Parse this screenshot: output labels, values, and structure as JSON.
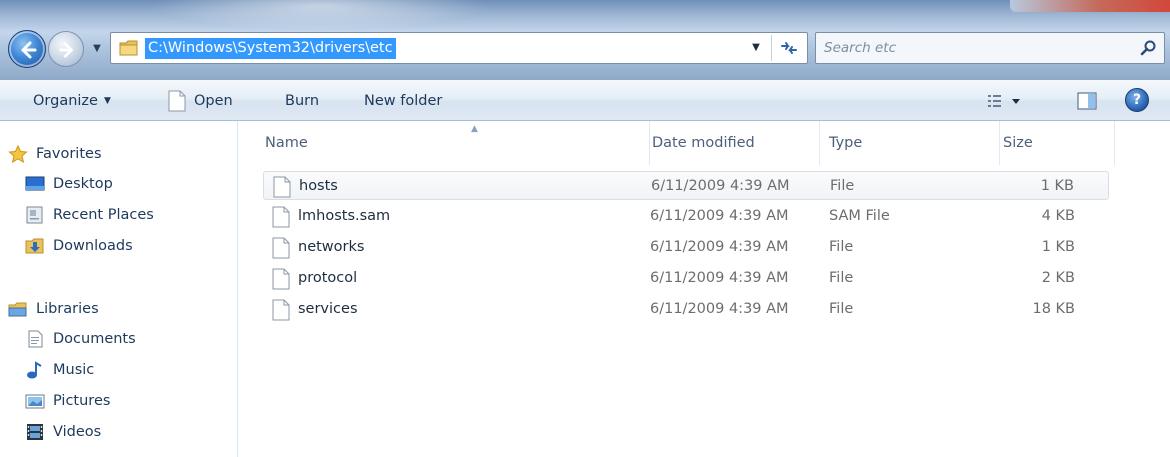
{
  "address": {
    "path": "C:\\Windows\\System32\\drivers\\etc"
  },
  "search": {
    "placeholder": "Search etc"
  },
  "toolbar": {
    "organize_label": "Organize",
    "open_label": "Open",
    "burn_label": "Burn",
    "new_folder_label": "New folder",
    "help_label": "?"
  },
  "sidebar": {
    "favorites": {
      "label": "Favorites",
      "items": [
        {
          "label": "Desktop",
          "icon": "desktop-icon"
        },
        {
          "label": "Recent Places",
          "icon": "recent-places-icon"
        },
        {
          "label": "Downloads",
          "icon": "downloads-icon"
        }
      ]
    },
    "libraries": {
      "label": "Libraries",
      "items": [
        {
          "label": "Documents",
          "icon": "documents-icon"
        },
        {
          "label": "Music",
          "icon": "music-icon"
        },
        {
          "label": "Pictures",
          "icon": "pictures-icon"
        },
        {
          "label": "Videos",
          "icon": "videos-icon"
        }
      ]
    }
  },
  "filelist": {
    "columns": {
      "name": "Name",
      "date": "Date modified",
      "type": "Type",
      "size": "Size"
    },
    "rows": [
      {
        "name": "hosts",
        "date": "6/11/2009 4:39 AM",
        "type": "File",
        "size": "1 KB"
      },
      {
        "name": "lmhosts.sam",
        "date": "6/11/2009 4:39 AM",
        "type": "SAM File",
        "size": "4 KB"
      },
      {
        "name": "networks",
        "date": "6/11/2009 4:39 AM",
        "type": "File",
        "size": "1 KB"
      },
      {
        "name": "protocol",
        "date": "6/11/2009 4:39 AM",
        "type": "File",
        "size": "2 KB"
      },
      {
        "name": "services",
        "date": "6/11/2009 4:39 AM",
        "type": "File",
        "size": "18 KB"
      }
    ]
  },
  "colors": {
    "selection": "#3399ff",
    "text": "#1e395b",
    "muted_text": "#6d6d6d"
  }
}
